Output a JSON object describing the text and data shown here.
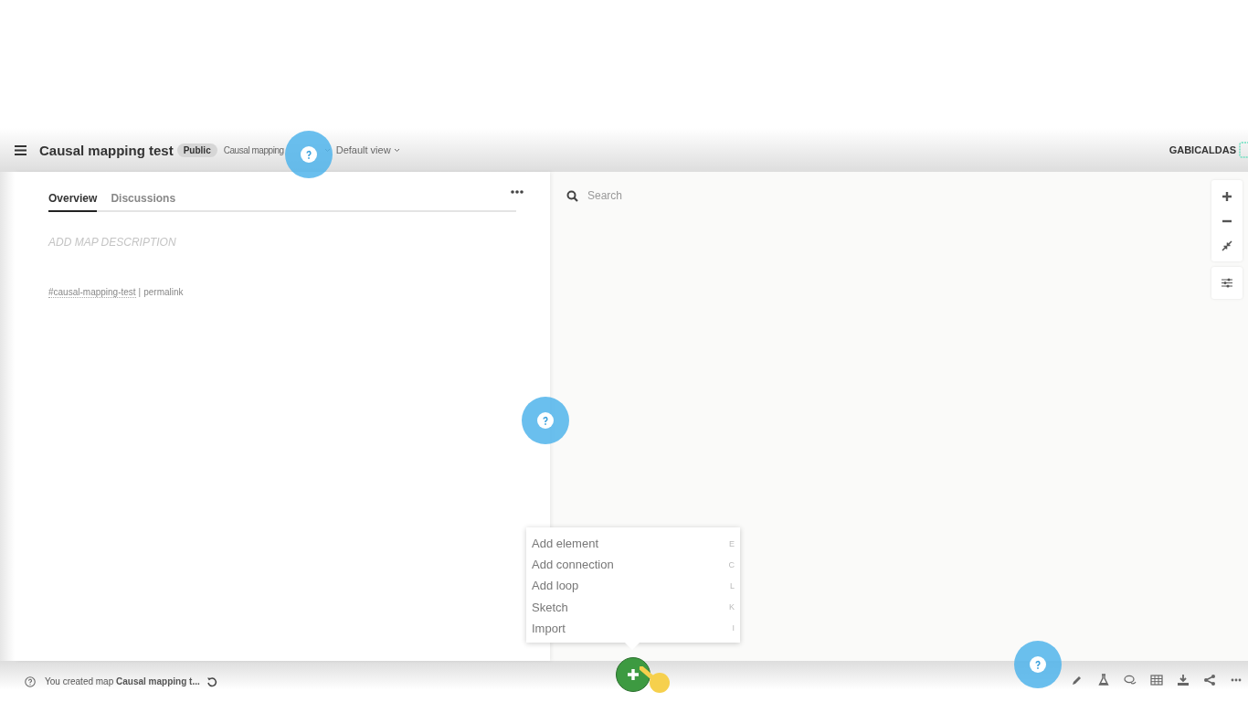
{
  "header": {
    "title": "Causal mapping test",
    "badge": "Public",
    "breadcrumb": "Causal mapping",
    "view": "Default view",
    "user": "GABICALDAS"
  },
  "side_panel": {
    "tabs": [
      {
        "label": "Overview",
        "selected": true
      },
      {
        "label": "Discussions",
        "selected": false
      }
    ],
    "description_placeholder": "ADD MAP DESCRIPTION",
    "hashtag": "#causal-mapping-test",
    "separator": "|",
    "permalink": "permalink"
  },
  "canvas": {
    "search": {
      "placeholder": "Search"
    }
  },
  "add_menu": {
    "items": [
      {
        "label": "Add element",
        "shortcut": "E"
      },
      {
        "label": "Add connection",
        "shortcut": "C"
      },
      {
        "label": "Add loop",
        "shortcut": "L"
      },
      {
        "label": "Sketch",
        "shortcut": "K"
      },
      {
        "label": "Import",
        "shortcut": "I"
      }
    ]
  },
  "status_bar": {
    "message": "You created map **Causal mapping t...**"
  }
}
